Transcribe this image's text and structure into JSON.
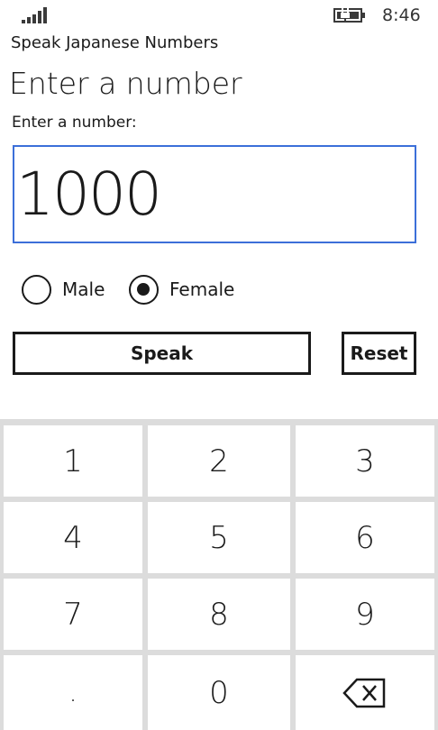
{
  "status_bar": {
    "time": "8:46",
    "signal_icon": "signal-strength-icon",
    "battery_icon": "battery-charging-icon"
  },
  "app": {
    "name": "Speak Japanese Numbers",
    "page_title": "Enter a number"
  },
  "form": {
    "label": "Enter a number:",
    "value": "1000",
    "accent_color": "#3c6fd9",
    "gender_options": [
      {
        "label": "Male",
        "selected": false
      },
      {
        "label": "Female",
        "selected": true
      }
    ],
    "speak_label": "Speak",
    "reset_label": "Reset"
  },
  "keypad": {
    "keys": [
      "1",
      "2",
      "3",
      "4",
      "5",
      "6",
      "7",
      "8",
      "9",
      ".",
      "0"
    ],
    "backspace_icon": "backspace-icon"
  }
}
